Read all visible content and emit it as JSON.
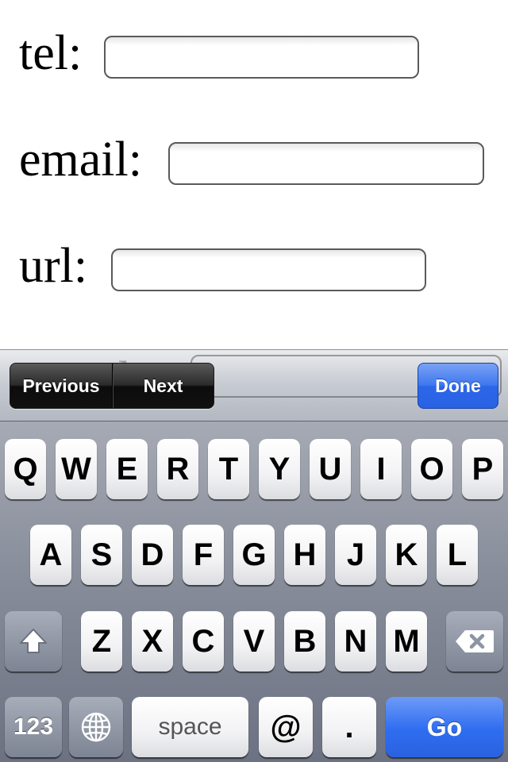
{
  "form": {
    "rows": [
      {
        "label": "tel:",
        "value": ""
      },
      {
        "label": "email:",
        "value": ""
      },
      {
        "label": "url:",
        "value": ""
      }
    ],
    "peek_label": "search:"
  },
  "accessory_bar": {
    "previous": "Previous",
    "next": "Next",
    "done": "Done"
  },
  "keyboard": {
    "row1": [
      "Q",
      "W",
      "E",
      "R",
      "T",
      "Y",
      "U",
      "I",
      "O",
      "P"
    ],
    "row2": [
      "A",
      "S",
      "D",
      "F",
      "G",
      "H",
      "J",
      "K",
      "L"
    ],
    "row3": [
      "Z",
      "X",
      "C",
      "V",
      "B",
      "N",
      "M"
    ],
    "bottom": {
      "numbers": "123",
      "space": "space",
      "at": "@",
      "dot": ".",
      "go": "Go"
    },
    "icons": {
      "shift": "shift-icon",
      "backspace": "backspace-icon",
      "globe": "globe-icon"
    },
    "colors": {
      "accent_blue": "#2f6df0",
      "keyboard_bg": "#878d9a"
    }
  }
}
